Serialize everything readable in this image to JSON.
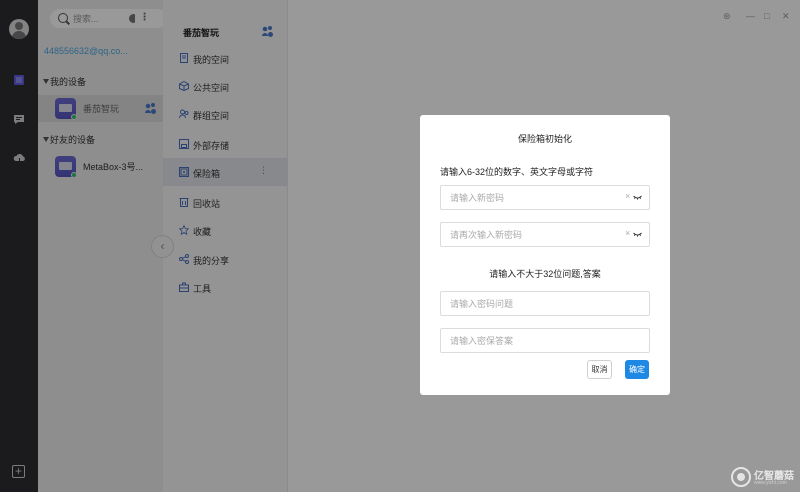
{
  "sidebar_rail": {
    "icons": [
      "user-avatar",
      "device-box-icon",
      "chat-icon",
      "cloud-icon",
      "add-icon"
    ]
  },
  "devices_panel": {
    "search_placeholder": "搜索...",
    "account": "448556632@qq.co...",
    "my_devices_label": "我的设备",
    "friend_devices_label": "好友的设备",
    "my_devices": [
      {
        "name": "番茄智玩"
      }
    ],
    "friend_devices": [
      {
        "name": "MetaBox-3号..."
      }
    ]
  },
  "spaces_panel": {
    "title": "番茄智玩",
    "items": [
      {
        "label": "我的空间",
        "icon": "doc-icon"
      },
      {
        "label": "公共空间",
        "icon": "cube-icon"
      },
      {
        "label": "群组空间",
        "icon": "group-icon"
      },
      {
        "label": "外部存储",
        "icon": "storage-icon"
      },
      {
        "label": "保险箱",
        "icon": "safe-icon",
        "active": true
      },
      {
        "label": "回收站",
        "icon": "recycle-icon"
      },
      {
        "label": "收藏",
        "icon": "star-icon"
      },
      {
        "label": "我的分享",
        "icon": "share-icon"
      },
      {
        "label": "工具",
        "icon": "toolbox-icon"
      }
    ],
    "more": "⋮"
  },
  "window_controls": {
    "settings": "⊛",
    "minimize": "—",
    "maximize": "□",
    "close": "✕"
  },
  "dialog": {
    "title": "保险箱初始化",
    "password_hint": "请输入6-32位的数字、英文字母或字符",
    "new_password_placeholder": "请输入新密码",
    "confirm_password_placeholder": "请再次输入新密码",
    "question_hint": "请输入不大于32位问题,答案",
    "question_placeholder": "请输入密码问题",
    "answer_placeholder": "请输入密保答案",
    "clear_symbol": "×",
    "cancel_label": "取消",
    "ok_label": "确定"
  },
  "watermark": {
    "text": "亿智蘑菇",
    "sub": "www.yizhi.com"
  },
  "colors": {
    "accent": "#1e88e5",
    "account": "#4aa8e0",
    "rail": "#2e2e33"
  }
}
